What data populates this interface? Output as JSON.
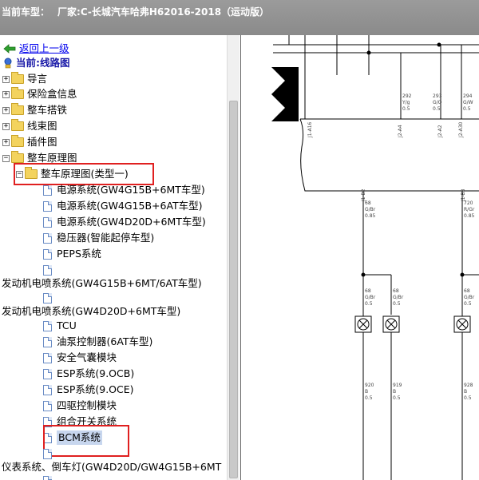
{
  "title": {
    "label": "当前车型：",
    "value": "厂家:C-长城汽车哈弗H62016-2018（运动版）"
  },
  "tree": {
    "back_link": "返回上一级",
    "current": "当前:线路图",
    "folders": [
      "导言",
      "保险盒信息",
      "整车搭铁",
      "线束图",
      "插件图",
      "整车原理图"
    ],
    "subfolder": "整车原理图(类型一)",
    "items": [
      "电源系统(GW4G15B+6MT车型)",
      "电源系统(GW4G15B+6AT车型)",
      "电源系统(GW4D20D+6MT车型)",
      "稳压器(智能起停车型)",
      "PEPS系统",
      "发动机电喷系统(GW4G15B+6MT/6AT车型)",
      "发动机电喷系统(GW4D20D+6MT车型)",
      "TCU",
      "油泵控制器(6AT车型)",
      "安全气囊模块",
      "ESP系统(9.OCB)",
      "ESP系统(9.OCE)",
      "四驱控制模块",
      "组合开关系统",
      "BCM系统",
      "仪表系统、倒车灯(GW4D20D/GW4G15B+6MT"
    ]
  },
  "diagram": {
    "wires_top": [
      {
        "num": "292",
        "color": "Y/g",
        "size": "0.5"
      },
      {
        "num": "293",
        "color": "G/O",
        "size": "0.5"
      },
      {
        "num": "294",
        "color": "G/W",
        "size": "0.5"
      }
    ],
    "connectors_top": [
      "J1-A16",
      "J2-A4",
      "J2-A2",
      "J2-A30"
    ],
    "connectors_mid": [
      "J1-B2",
      "J1-B3"
    ],
    "wires_mid": [
      {
        "num": "68",
        "color": "G/Br",
        "size": "0.85"
      },
      {
        "num": "720",
        "color": "R/Gr",
        "size": "0.85"
      }
    ],
    "wires_lamp": [
      {
        "num": "68",
        "color": "G/Br",
        "size": "0.5"
      },
      {
        "num": "68",
        "color": "G/Br",
        "size": "0.5"
      },
      {
        "num": "68",
        "color": "G/Br",
        "size": "0.5"
      }
    ],
    "wires_bottom": [
      {
        "num": "920",
        "color": "B",
        "size": "0.5"
      },
      {
        "num": "919",
        "color": "B",
        "size": "0.5"
      },
      {
        "num": "928",
        "color": "B",
        "size": "0.5"
      }
    ]
  },
  "colors": {
    "title_bar": "#8f8f8f",
    "highlight_box": "#e02020",
    "selection": "#c7d6ee",
    "link": "#0000ee"
  },
  "icons": [
    "folder-icon",
    "document-icon",
    "back-arrow-icon",
    "current-location-icon"
  ]
}
